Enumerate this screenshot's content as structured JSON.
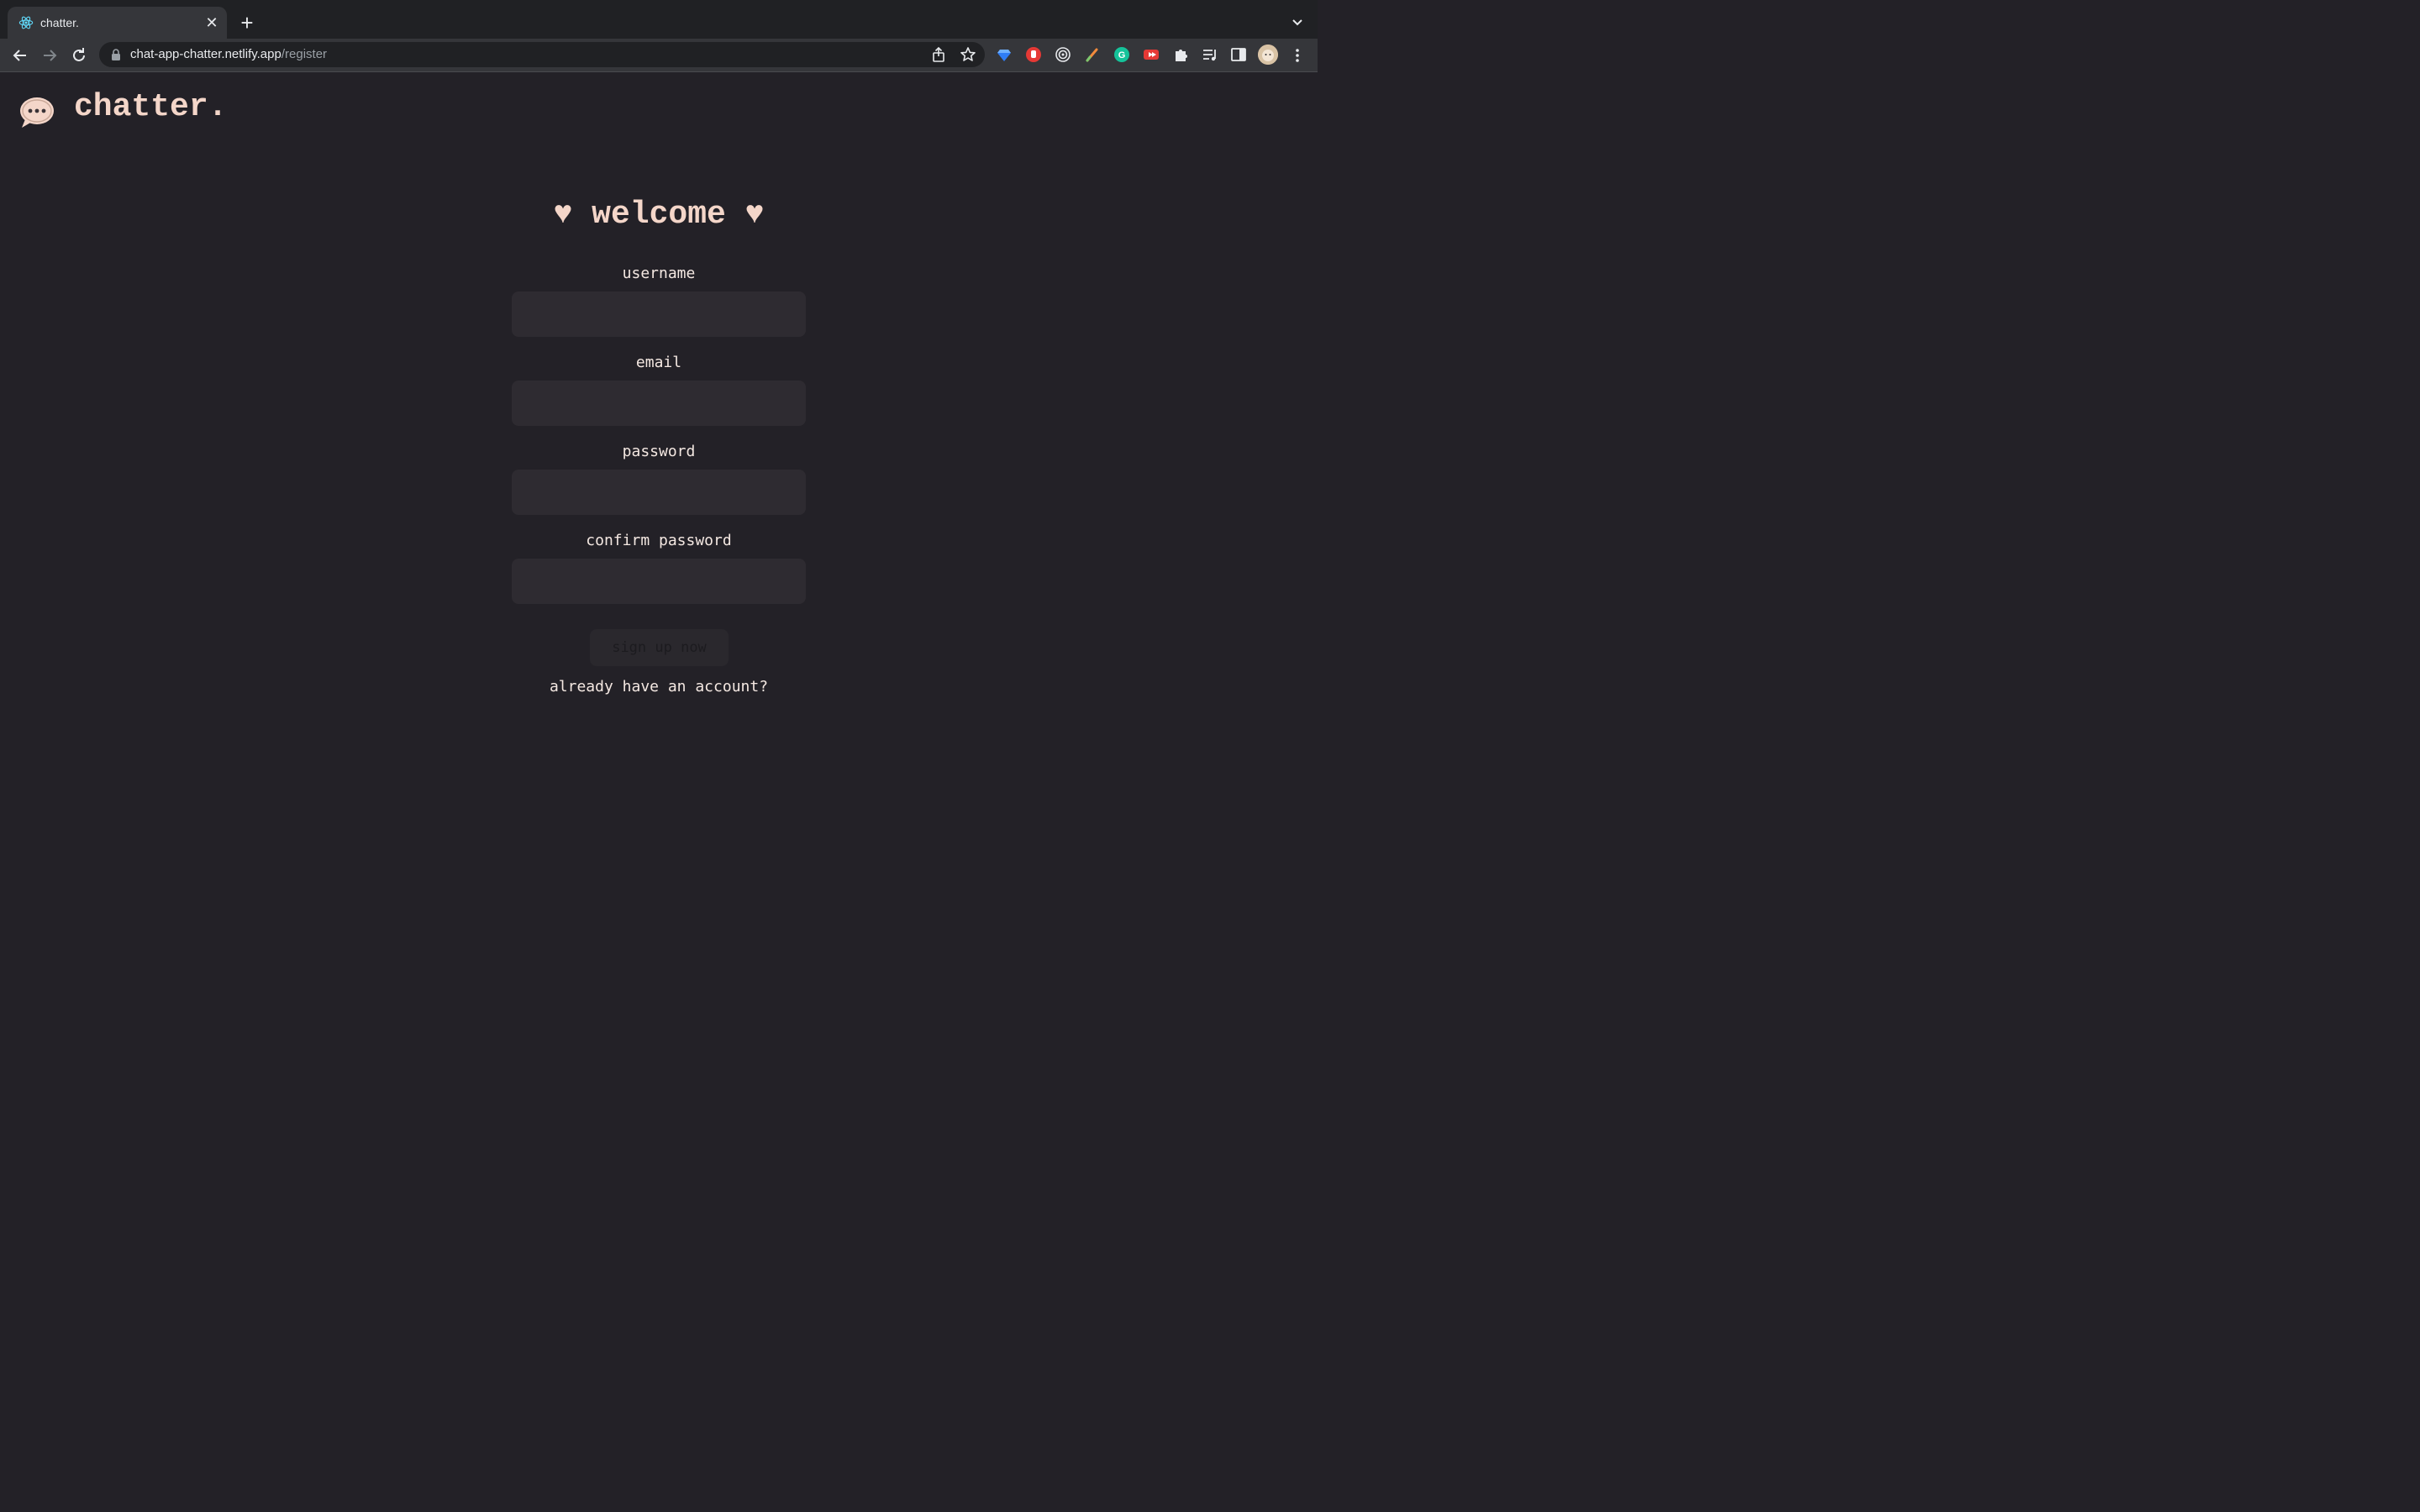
{
  "browser": {
    "tab": {
      "title": "chatter.",
      "favicon": "react-atom-icon"
    },
    "url": {
      "host": "chat-app-chatter.netlify.app",
      "path": "/register"
    },
    "extensions": [
      "gem-icon",
      "hand-block-icon",
      "target-icon",
      "pen-icon",
      "grammarly-icon",
      "youtube-icon",
      "puzzle-icon",
      "playlist-icon",
      "sidebar-icon"
    ]
  },
  "header": {
    "app_name": "chatter.",
    "logo_icon": "speech-bubble-icon"
  },
  "form": {
    "title": "♥ welcome ♥",
    "fields": [
      {
        "label": "username",
        "value": ""
      },
      {
        "label": "email",
        "value": ""
      },
      {
        "label": "password",
        "value": ""
      },
      {
        "label": "confirm password",
        "value": ""
      }
    ],
    "submit_label": "sign up now",
    "login_link": "already have an account?"
  },
  "colors": {
    "background": "#232127",
    "accent": "#f4d6c9",
    "input_bg": "#2e2b31"
  }
}
